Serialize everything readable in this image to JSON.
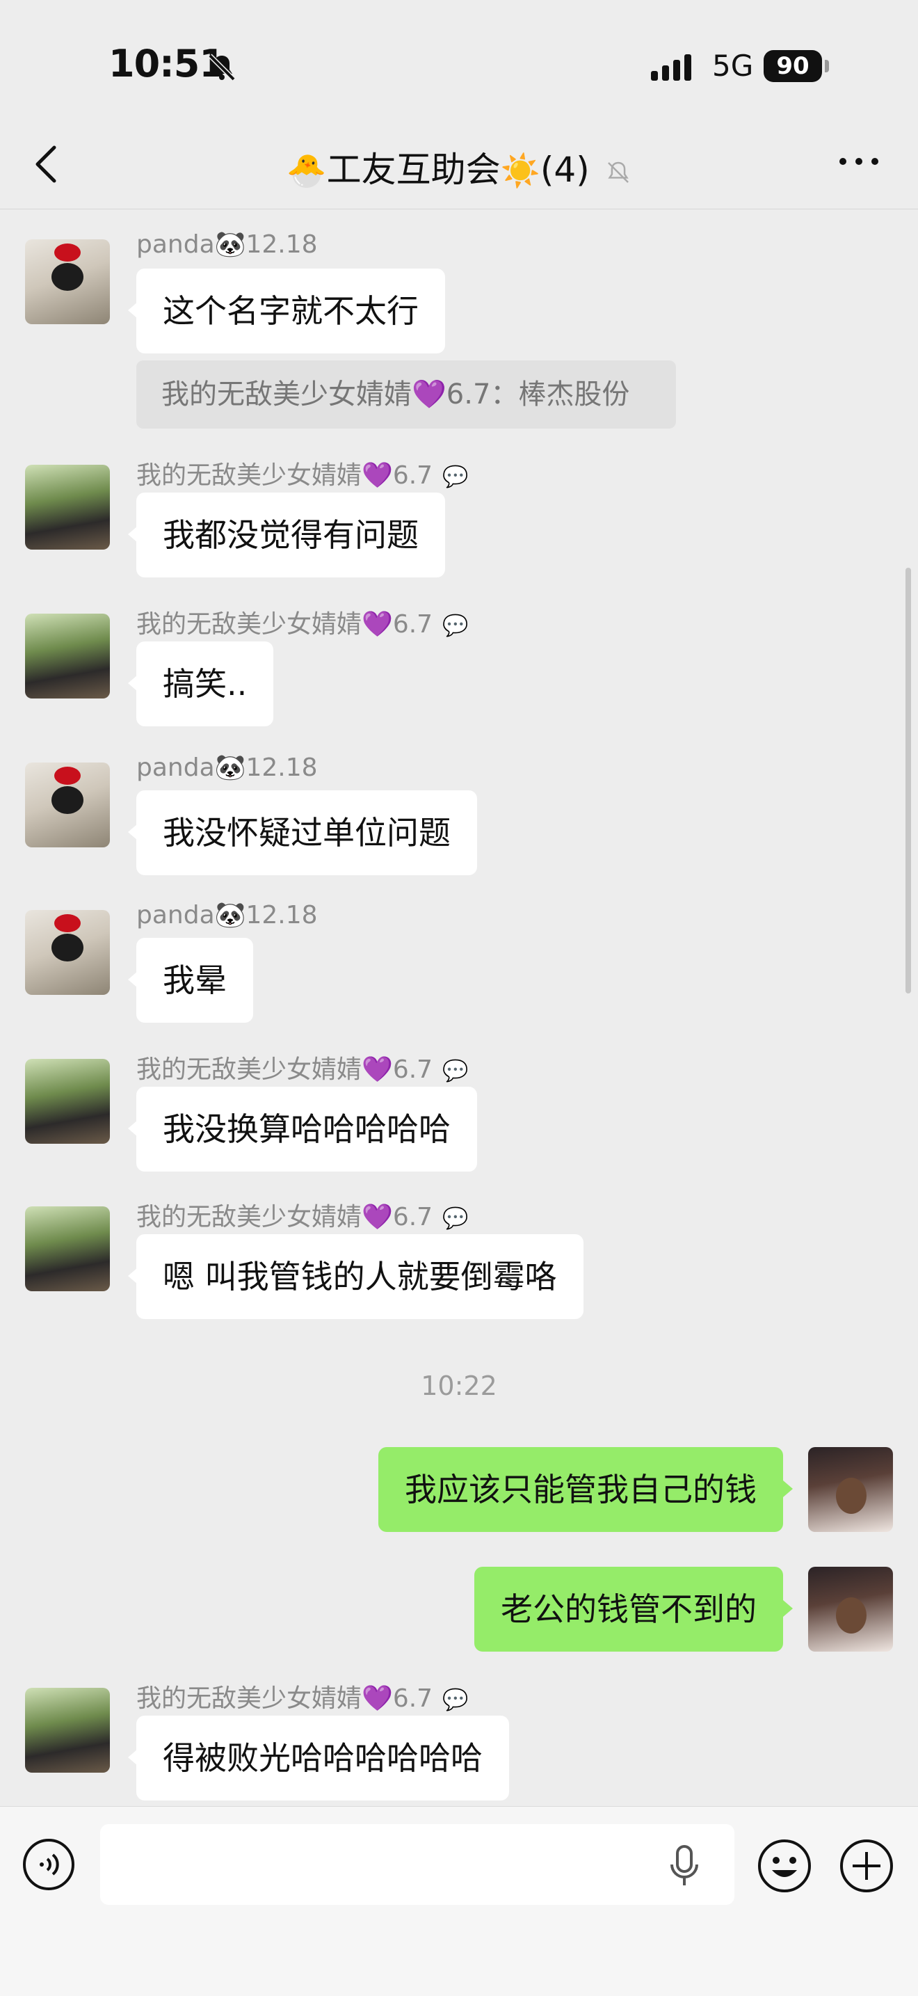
{
  "status_bar": {
    "time": "10:51",
    "network": "5G",
    "battery": "90"
  },
  "header": {
    "title_prefix_icon": "🐣",
    "title": "工友互助会",
    "title_suffix_icon": "☀️",
    "member_count": "(4)",
    "icons": [
      "back-chevron-icon",
      "mute-bell-icon",
      "more-dots-icon"
    ]
  },
  "messages": [
    {
      "sender": "panda🐼12.18",
      "text": "这个名字就不太行",
      "quote": "我的无敌美少女婧婧💜6.7：棒杰股份"
    },
    {
      "sender": "我的无敌美少女婧婧💜6.7",
      "badge": "💬",
      "text": "我都没觉得有问题"
    },
    {
      "sender": "我的无敌美少女婧婧💜6.7",
      "badge": "💬",
      "text": "搞笑.."
    },
    {
      "sender": "panda🐼12.18",
      "text": "我没怀疑过单位问题"
    },
    {
      "sender": "panda🐼12.18",
      "text": "我晕"
    },
    {
      "sender": "我的无敌美少女婧婧💜6.7",
      "badge": "💬",
      "text": "我没换算哈哈哈哈哈"
    },
    {
      "sender": "我的无敌美少女婧婧💜6.7",
      "badge": "💬",
      "text": "嗯 叫我管钱的人就要倒霉咯"
    },
    {
      "timestamp": "10:22"
    },
    {
      "outgoing": true,
      "text": "我应该只能管我自己的钱"
    },
    {
      "outgoing": true,
      "text": "老公的钱管不到的"
    },
    {
      "sender": "我的无敌美少女婧婧💜6.7",
      "badge": "💬",
      "text": "得被败光哈哈哈哈哈哈"
    }
  ],
  "input_bar": {
    "placeholder": "",
    "icons": [
      "voice-wave-icon",
      "microphone-icon",
      "emoji-icon",
      "plus-icon"
    ]
  },
  "colors": {
    "background": "#ededed",
    "incoming_bubble": "#ffffff",
    "outgoing_bubble": "#95ec69",
    "sender_text": "#8a8a8a"
  }
}
